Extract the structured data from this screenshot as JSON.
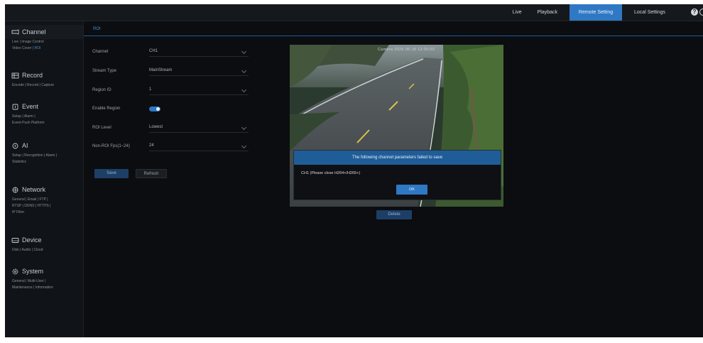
{
  "topbar": {
    "nav": [
      "Live",
      "Playback",
      "Remote Setting",
      "Local Settings"
    ],
    "active": "Remote Setting"
  },
  "sidebar": {
    "sections": [
      {
        "title": "Channel",
        "icon": "camera-icon",
        "links": [
          "Live",
          "Image Control",
          "Video Cover",
          "ROI"
        ],
        "active_link": "ROI"
      },
      {
        "title": "Record",
        "icon": "record-icon",
        "links": [
          "Encode",
          "Record",
          "Capture"
        ]
      },
      {
        "title": "Event",
        "icon": "event-icon",
        "links": [
          "Setup",
          "Alarm",
          "Event Push Platform"
        ]
      },
      {
        "title": "AI",
        "icon": "ai-icon",
        "links": [
          "Setup",
          "Recognition",
          "Alarm",
          "Statistics"
        ]
      },
      {
        "title": "Network",
        "icon": "network-icon",
        "links": [
          "General",
          "Email",
          "FTP",
          "RTSP",
          "DDNS",
          "HTTPS",
          "IP Filter"
        ]
      },
      {
        "title": "Device",
        "icon": "device-icon",
        "links": [
          "Disk",
          "Audio",
          "Cloud"
        ]
      },
      {
        "title": "System",
        "icon": "system-icon",
        "links": [
          "General",
          "Multi-User",
          "Maintenance",
          "Information"
        ]
      }
    ]
  },
  "content": {
    "tab": "ROI",
    "form": {
      "channel_label": "Channel",
      "channel_value": "CH1",
      "stream_label": "Stream Type",
      "stream_value": "MainStream",
      "region_label": "Region ID",
      "region_value": "1",
      "enable_label": "Enable Region",
      "roi_level_label": "ROI Level",
      "roi_level_value": "Lowest",
      "fps_label": "Non-ROI Fps(1~24)",
      "fps_value": "24"
    },
    "buttons": {
      "save": "Save",
      "refresh": "Refresh",
      "delete": "Delete"
    },
    "video": {
      "osd": "Camera    2025-06-18 12:00:00"
    }
  },
  "dialog": {
    "title": "The following channel parameters failed to save",
    "message": "CH1 (Please close H264+/H265+)",
    "ok": "OK"
  }
}
